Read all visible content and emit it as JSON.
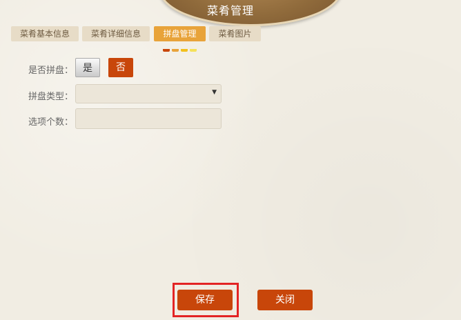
{
  "header": {
    "title": "菜肴管理"
  },
  "tabs": [
    {
      "label": "菜肴基本信息",
      "active": false
    },
    {
      "label": "菜肴详细信息",
      "active": false
    },
    {
      "label": "拼盘管理",
      "active": true
    },
    {
      "label": "菜肴图片",
      "active": false
    }
  ],
  "colors": {
    "accent": "#c8460a",
    "active_tab": "#e8a33a",
    "highlight": "#e32424",
    "banner": "#8f6a3b",
    "background": "#f1ede3",
    "tab_dots": [
      "#c8460a",
      "#e8a33a",
      "#f2c01d",
      "#f5e15a"
    ]
  },
  "form": {
    "platter_label": "是否拼盘：",
    "platter_yes": "是",
    "platter_no": "否",
    "platter_selected": "否",
    "type_label": "拼盘类型：",
    "type_value": "",
    "count_label": "选项个数：",
    "count_value": ""
  },
  "actions": {
    "save_label": "保存",
    "close_label": "关闭"
  }
}
